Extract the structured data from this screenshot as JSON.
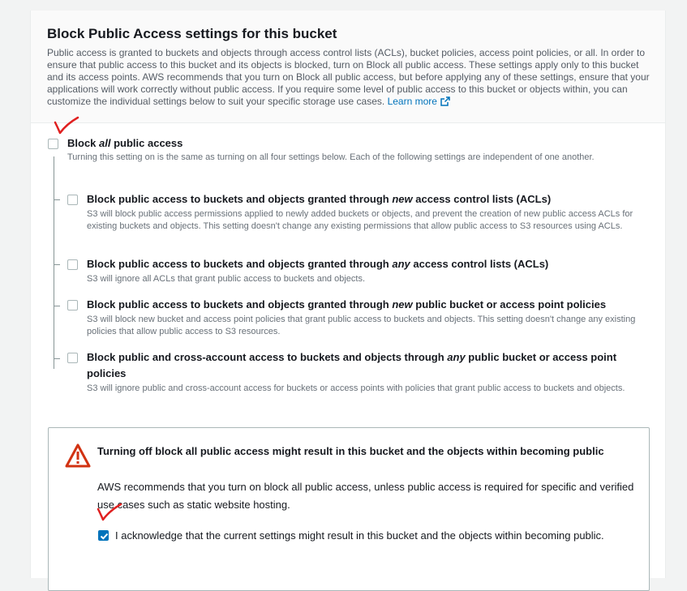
{
  "section": {
    "title": "Block Public Access settings for this bucket",
    "description": "Public access is granted to buckets and objects through access control lists (ACLs), bucket policies, access point policies, or all. In order to ensure that public access to this bucket and its objects is blocked, turn on Block all public access. These settings apply only to this bucket and its access points. AWS recommends that you turn on Block all public access, but before applying any of these settings, ensure that your applications will work correctly without public access. If you require some level of public access to this bucket or objects within, you can customize the individual settings below to suit your specific storage use cases.",
    "learn_more": "Learn more"
  },
  "block_all": {
    "label_pre": "Block ",
    "label_em": "all",
    "label_post": " public access",
    "description": "Turning this setting on is the same as turning on all four settings below. Each of the following settings are independent of one another.",
    "checked": false
  },
  "options": [
    {
      "pre": "Block public access to buckets and objects granted through ",
      "em": "new",
      "post": " access control lists (ACLs)",
      "description": "S3 will block public access permissions applied to newly added buckets or objects, and prevent the creation of new public access ACLs for existing buckets and objects. This setting doesn't change any existing permissions that allow public access to S3 resources using ACLs.",
      "checked": false
    },
    {
      "pre": "Block public access to buckets and objects granted through ",
      "em": "any",
      "post": " access control lists (ACLs)",
      "description": "S3 will ignore all ACLs that grant public access to buckets and objects.",
      "checked": false
    },
    {
      "pre": "Block public access to buckets and objects granted through ",
      "em": "new",
      "post": " public bucket or access point policies",
      "description": "S3 will block new bucket and access point policies that grant public access to buckets and objects. This setting doesn't change any existing policies that allow public access to S3 resources.",
      "checked": false
    },
    {
      "pre": "Block public and cross-account access to buckets and objects through ",
      "em": "any",
      "post": " public bucket or access point policies",
      "description": "S3 will ignore public and cross-account access for buckets or access points with policies that grant public access to buckets and objects.",
      "checked": false
    }
  ],
  "warning": {
    "icon": "warning-triangle-icon",
    "title": "Turning off block all public access might result in this bucket and the objects within becoming public",
    "body": "AWS recommends that you turn on block all public access, unless public access is required for specific and verified use cases such as static website hosting.",
    "ack_label": "I acknowledge that the current settings might result in this bucket and the objects within becoming public.",
    "ack_checked": true
  },
  "colors": {
    "accent": "#0073bb",
    "warning": "#d13212",
    "annotation": "#e02020"
  }
}
